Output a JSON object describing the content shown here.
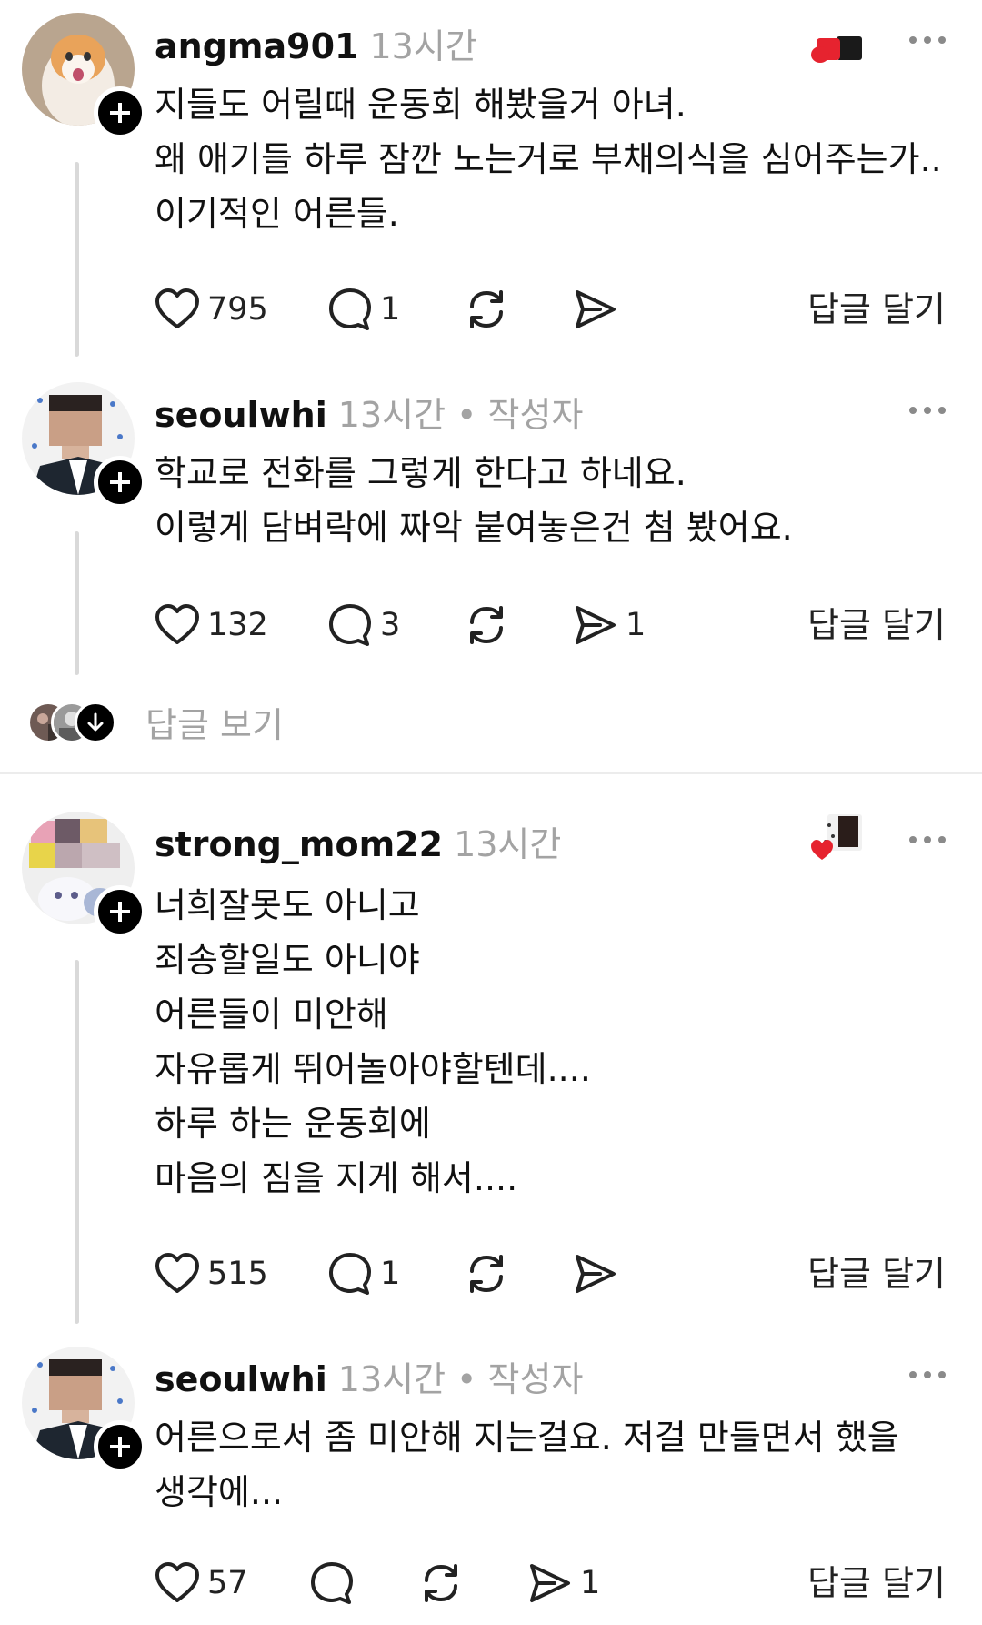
{
  "posts": [
    {
      "username": "angma901",
      "time": "13시간",
      "author_tag": "",
      "lines": [
        "지들도 어릴때 운동회 해봤을거 아녀.",
        "왜 애기들 하루 잠깐 노는거로 부채의식을 심어주는가..",
        "이기적인 어른들."
      ],
      "likes": "795",
      "comments": "1",
      "shares": "",
      "reply_label": "답글 달기"
    },
    {
      "username": "seoulwhi",
      "time": "13시간",
      "author_tag": "• 작성자",
      "lines": [
        "학교로 전화를 그렇게 한다고 하네요.",
        "이렇게 담벼락에 짜악 붙여놓은건 첨 봤어요."
      ],
      "likes": "132",
      "comments": "3",
      "shares": "1",
      "reply_label": "답글 달기"
    },
    {
      "username": "strong_mom22",
      "time": "13시간",
      "author_tag": "",
      "lines": [
        "너희잘못도 아니고",
        "죄송할일도 아니야",
        "어른들이 미안해",
        "자유롭게 뛰어놀아야할텐데....",
        "하루 하는 운동회에",
        "마음의 짐을 지게 해서...."
      ],
      "likes": "515",
      "comments": "1",
      "shares": "",
      "reply_label": "답글 달기"
    },
    {
      "username": "seoulwhi",
      "time": "13시간",
      "author_tag": "• 작성자",
      "lines": [
        "어른으로서 좀 미안해 지는걸요. 저걸 만들면서 했을",
        "생각에..."
      ],
      "likes": "57",
      "comments": "",
      "shares": "1",
      "reply_label": "답글 달기"
    }
  ],
  "view_replies": "답글 보기",
  "icons": [
    "heart-icon",
    "comment-icon",
    "repost-icon",
    "share-icon",
    "more-icon",
    "follow-plus-icon",
    "arrow-down-icon"
  ]
}
